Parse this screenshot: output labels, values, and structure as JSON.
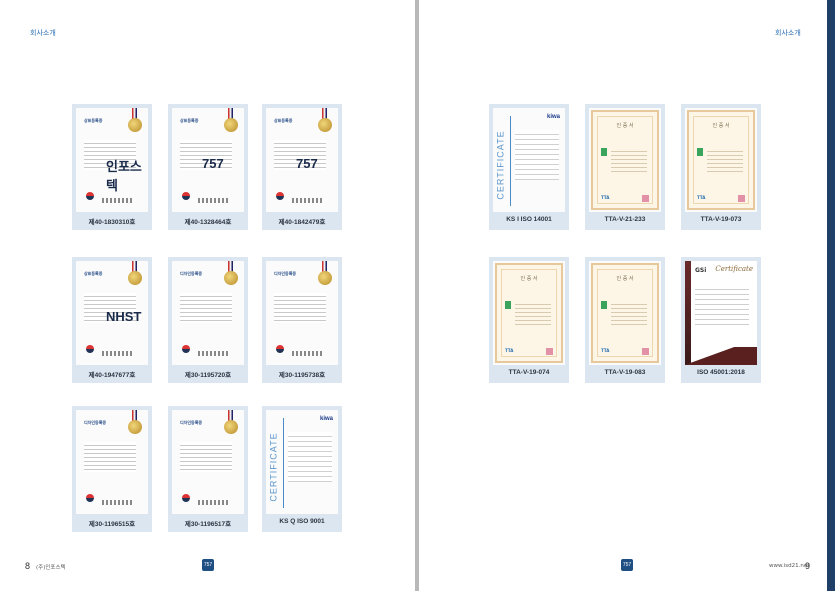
{
  "left_page": {
    "header": "회사소개",
    "page_number": "8",
    "footer_text": "(주)인포스텍",
    "certificates": [
      {
        "caption": "제40-1830310호",
        "style": "kr-patent",
        "title": "상표등록증",
        "mark": "인포스텍"
      },
      {
        "caption": "제40-1328464호",
        "style": "kr-patent",
        "title": "상표등록증",
        "mark": "757"
      },
      {
        "caption": "제40-1842479호",
        "style": "kr-patent",
        "title": "상표등록증",
        "mark": "757"
      },
      {
        "caption": "제40-1947677호",
        "style": "kr-patent",
        "title": "상표등록증",
        "mark": "NHST"
      },
      {
        "caption": "제30-1195720호",
        "style": "kr-patent",
        "title": "디자인등록증",
        "mark": ""
      },
      {
        "caption": "제30-1195738호",
        "style": "kr-patent",
        "title": "디자인등록증",
        "mark": ""
      },
      {
        "caption": "제30-1196515호",
        "style": "kr-patent",
        "title": "디자인등록증",
        "mark": ""
      },
      {
        "caption": "제30-1196517호",
        "style": "kr-patent",
        "title": "디자인등록증",
        "mark": ""
      },
      {
        "caption": "KS Q ISO 9001",
        "style": "kiwa",
        "title": "CERTIFICATE",
        "mark": "kiwa"
      }
    ]
  },
  "right_page": {
    "header": "회사소개",
    "page_number": "9",
    "footer_text": "www.isd21.net",
    "certificates": [
      {
        "caption": "KS I ISO 14001",
        "style": "kiwa",
        "title": "CERTIFICATE",
        "mark": "kiwa"
      },
      {
        "caption": "TTA-V-21-233",
        "style": "tta",
        "title": "인 증 서",
        "mark": "TTA"
      },
      {
        "caption": "TTA-V-19-073",
        "style": "tta",
        "title": "인 증 서",
        "mark": "TTA"
      },
      {
        "caption": "TTA-V-19-074",
        "style": "tta",
        "title": "인 증 서",
        "mark": "TTA"
      },
      {
        "caption": "TTA-V-19-083",
        "style": "tta",
        "title": "인 증 서",
        "mark": "TTA"
      },
      {
        "caption": "ISO 45001:2018",
        "style": "gsi",
        "title": "Certificate",
        "mark": "GSi"
      }
    ]
  },
  "footer_logo": "757",
  "colors": {
    "accent": "#2a6fb3",
    "card_bg": "#dce6f0",
    "navy": "#1f3f66"
  }
}
